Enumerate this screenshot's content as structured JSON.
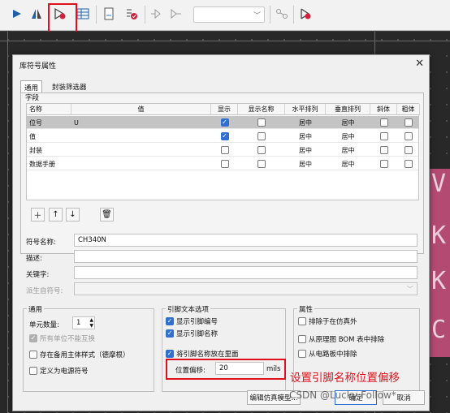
{
  "colors": {
    "highlight": "#e0101a",
    "accent": "#2f6fcf"
  },
  "toolbar": {
    "icons": [
      "arrow-right-icon",
      "flip-icon",
      "symbol-edit-icon",
      "table-icon",
      "doc-icon",
      "check-list-icon",
      "pin-in-icon",
      "pin-out-icon",
      "layer-combo",
      "link-icon",
      "symbol-add-icon"
    ],
    "combo_value": ""
  },
  "dialog": {
    "title": "库符号属性",
    "tabs": [
      "通用",
      "封装筛选器"
    ],
    "fields_group": "字段",
    "columns": [
      "名称",
      "值",
      "显示",
      "显示名称",
      "水平排列",
      "垂直排列",
      "斜体",
      "粗体"
    ],
    "rows": [
      {
        "name": "位号",
        "value": "U",
        "show": true,
        "show_name": false,
        "h": "居中",
        "v": "居中",
        "italic": false,
        "bold": false
      },
      {
        "name": "值",
        "value": "",
        "show": true,
        "show_name": false,
        "h": "居中",
        "v": "居中",
        "italic": false,
        "bold": false
      },
      {
        "name": "封装",
        "value": "",
        "show": false,
        "show_name": false,
        "h": "居中",
        "v": "居中",
        "italic": false,
        "bold": false
      },
      {
        "name": "数据手册",
        "value": "",
        "show": false,
        "show_name": false,
        "h": "居中",
        "v": "居中",
        "italic": false,
        "bold": false
      }
    ],
    "symbol_name_label": "符号名称:",
    "symbol_name_value": "CH340N",
    "desc_label": "描述:",
    "desc_value": "",
    "keywords_label": "关键字:",
    "keywords_value": "",
    "derived_label": "派生自符号:",
    "general": {
      "title": "通用",
      "units_label": "单元数量:",
      "units_value": "1",
      "all_units": "所有单位不能互换",
      "alt_style": "存在备用主体样式（德摩根）",
      "power": "定义为电源符号"
    },
    "pin_text": {
      "title": "引脚文本选项",
      "show_number": "显示引脚编号",
      "show_name": "显示引脚名称",
      "inside": "将引脚名称放在里面",
      "offset_label": "位置偏移:",
      "offset_value": "20",
      "offset_unit": "mils"
    },
    "attrs": {
      "title": "属性",
      "exclude_sim": "排除于在仿真外",
      "exclude_bom": "从原理图 BOM 表中排除",
      "exclude_board": "从电路板中排除"
    },
    "buttons": {
      "sim": "编辑仿真模型...",
      "ok": "确定",
      "cancel": "取消"
    }
  },
  "annotation": "设置引脚名称位置偏移",
  "watermark": "CSDN @Lucky Follow*",
  "canvas_text": [
    "V",
    "K",
    "K",
    "C"
  ]
}
